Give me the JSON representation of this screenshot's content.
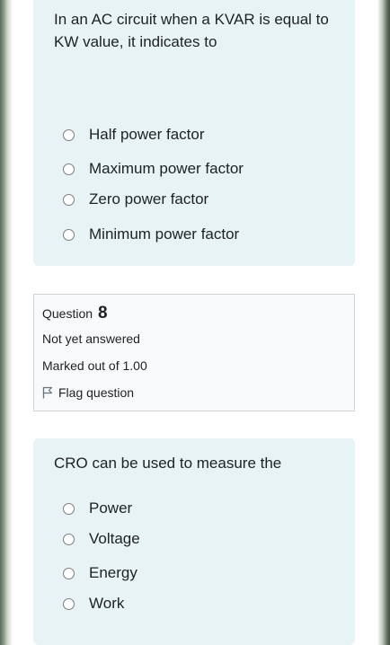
{
  "question7": {
    "text": "In an AC circuit when a KVAR is equal to KW value, it indicates to",
    "options": [
      "Half power factor",
      "Maximum power factor",
      "Zero power factor",
      "Minimum power factor"
    ]
  },
  "question8_info": {
    "question_label": "Question",
    "question_number": "8",
    "state": "Not yet answered",
    "grade": "Marked out of 1.00",
    "flag_label": "Flag question",
    "flag_icon": "flag-outline-icon"
  },
  "question8": {
    "text": "CRO can be used to measure the",
    "options": [
      "Power",
      "Voltage",
      "Energy",
      "Work"
    ]
  }
}
